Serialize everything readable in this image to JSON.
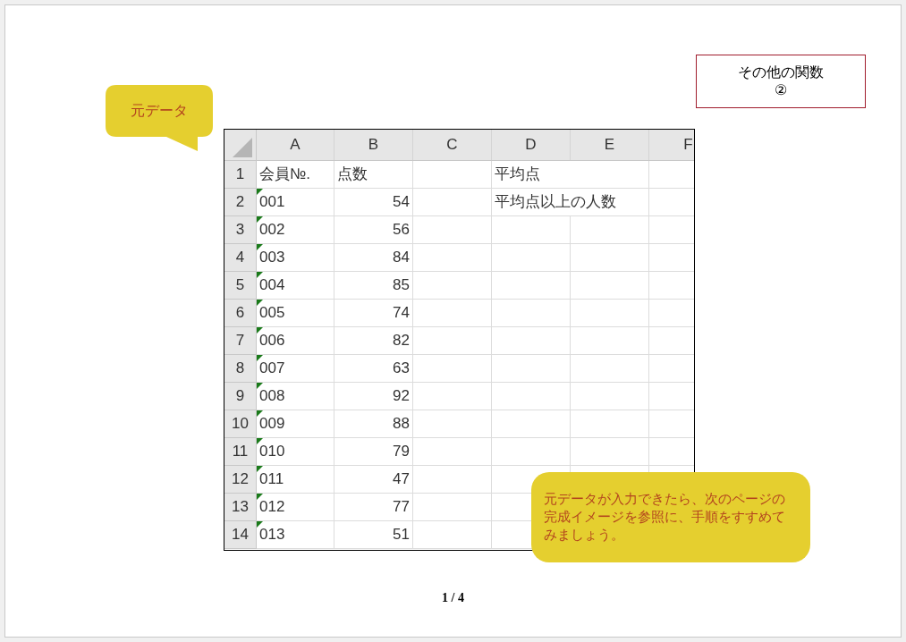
{
  "title_box": {
    "title": "その他の関数",
    "number": "②"
  },
  "callouts": [
    {
      "kind": "top",
      "text": "元データ"
    },
    {
      "kind": "bottom",
      "text": "元データが入力できたら、次のページの完成イメージを参照に、手順をすすめてみましょう。"
    }
  ],
  "sheet": {
    "columns": [
      "A",
      "B",
      "C",
      "D",
      "E",
      "F"
    ],
    "rows": [
      {
        "number": "1",
        "col_a": {
          "value": "会員№.",
          "kind": "text",
          "flagged": false
        },
        "col_b": {
          "value": "点数",
          "kind": "text"
        },
        "col_d": {
          "value": "平均点",
          "kind": "text"
        }
      },
      {
        "number": "2",
        "col_a": {
          "value": "001",
          "kind": "text",
          "flagged": true
        },
        "col_b": {
          "value": "54",
          "kind": "number"
        },
        "col_d": {
          "value": "平均点以上の人数",
          "kind": "text"
        }
      },
      {
        "number": "3",
        "col_a": {
          "value": "002",
          "kind": "text",
          "flagged": true
        },
        "col_b": {
          "value": "56",
          "kind": "number"
        }
      },
      {
        "number": "4",
        "col_a": {
          "value": "003",
          "kind": "text",
          "flagged": true
        },
        "col_b": {
          "value": "84",
          "kind": "number"
        }
      },
      {
        "number": "5",
        "col_a": {
          "value": "004",
          "kind": "text",
          "flagged": true
        },
        "col_b": {
          "value": "85",
          "kind": "number"
        }
      },
      {
        "number": "6",
        "col_a": {
          "value": "005",
          "kind": "text",
          "flagged": true
        },
        "col_b": {
          "value": "74",
          "kind": "number"
        }
      },
      {
        "number": "7",
        "col_a": {
          "value": "006",
          "kind": "text",
          "flagged": true
        },
        "col_b": {
          "value": "82",
          "kind": "number"
        }
      },
      {
        "number": "8",
        "col_a": {
          "value": "007",
          "kind": "text",
          "flagged": true
        },
        "col_b": {
          "value": "63",
          "kind": "number"
        }
      },
      {
        "number": "9",
        "col_a": {
          "value": "008",
          "kind": "text",
          "flagged": true
        },
        "col_b": {
          "value": "92",
          "kind": "number"
        }
      },
      {
        "number": "10",
        "col_a": {
          "value": "009",
          "kind": "text",
          "flagged": true
        },
        "col_b": {
          "value": "88",
          "kind": "number"
        }
      },
      {
        "number": "11",
        "col_a": {
          "value": "010",
          "kind": "text",
          "flagged": true
        },
        "col_b": {
          "value": "79",
          "kind": "number"
        }
      },
      {
        "number": "12",
        "col_a": {
          "value": "011",
          "kind": "text",
          "flagged": true
        },
        "col_b": {
          "value": "47",
          "kind": "number"
        }
      },
      {
        "number": "13",
        "col_a": {
          "value": "012",
          "kind": "text",
          "flagged": true
        },
        "col_b": {
          "value": "77",
          "kind": "number"
        }
      },
      {
        "number": "14",
        "col_a": {
          "value": "013",
          "kind": "text",
          "flagged": true
        },
        "col_b": {
          "value": "51",
          "kind": "number"
        }
      }
    ]
  },
  "page_indicator": {
    "current": "1",
    "separator": "/",
    "total": "4"
  }
}
